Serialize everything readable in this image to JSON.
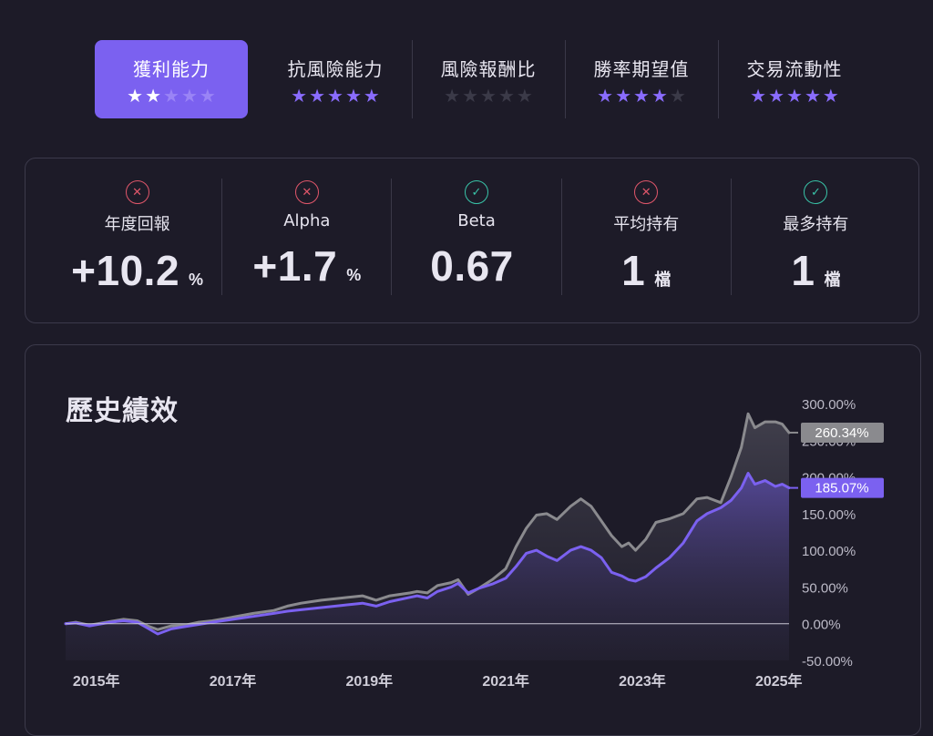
{
  "rating_tabs": [
    {
      "label": "獲利能力",
      "stars": 2,
      "max_stars": 5,
      "active": true
    },
    {
      "label": "抗風險能力",
      "stars": 5,
      "max_stars": 5,
      "active": false
    },
    {
      "label": "風險報酬比",
      "stars": 0,
      "max_stars": 5,
      "active": false
    },
    {
      "label": "勝率期望值",
      "stars": 4,
      "max_stars": 5,
      "active": false
    },
    {
      "label": "交易流動性",
      "stars": 5,
      "max_stars": 5,
      "active": false
    }
  ],
  "metrics": [
    {
      "label": "年度回報",
      "value": "+10.2",
      "unit": "%",
      "status": "bad",
      "icon": "x-circle-icon"
    },
    {
      "label": "Alpha",
      "value": "+1.7",
      "unit": "%",
      "status": "bad",
      "icon": "x-circle-icon"
    },
    {
      "label": "Beta",
      "value": "0.67",
      "unit": "",
      "status": "good",
      "icon": "check-circle-icon"
    },
    {
      "label": "平均持有",
      "value": "1",
      "unit": "檔",
      "status": "bad",
      "icon": "x-circle-icon"
    },
    {
      "label": "最多持有",
      "value": "1",
      "unit": "檔",
      "status": "good",
      "icon": "check-circle-icon"
    }
  ],
  "colors": {
    "background": "#1d1b28",
    "accent": "#7b61f0",
    "benchmark": "#8a8a8e",
    "bad": "#e0566a",
    "good": "#39c4a8"
  },
  "history": {
    "title": "歷史績效"
  },
  "chart_data": {
    "type": "line",
    "x_tick_labels": [
      "2015年",
      "2017年",
      "2019年",
      "2021年",
      "2023年",
      "2025年"
    ],
    "x_ticks": [
      2015.3,
      2017.3,
      2019.3,
      2021.3,
      2023.3,
      2025.3
    ],
    "xlim": [
      2014.85,
      2025.45
    ],
    "y_tick_labels": [
      "300.00%",
      "250.00%",
      "200.00%",
      "150.00%",
      "100.00%",
      "50.00%",
      "0.00%",
      "-50.00%"
    ],
    "y_ticks": [
      300,
      250,
      200,
      150,
      100,
      50,
      0,
      -50
    ],
    "ylim": [
      -50,
      300
    ],
    "grid": false,
    "series": [
      {
        "color": "#8a8a8e",
        "end_label": "260.34%",
        "points": [
          [
            2014.85,
            0
          ],
          [
            2015.0,
            2
          ],
          [
            2015.2,
            -2
          ],
          [
            2015.5,
            3
          ],
          [
            2015.7,
            6
          ],
          [
            2015.9,
            4
          ],
          [
            2016.05,
            -3
          ],
          [
            2016.2,
            -8
          ],
          [
            2016.4,
            -3
          ],
          [
            2016.6,
            -2
          ],
          [
            2016.8,
            2
          ],
          [
            2017.0,
            4
          ],
          [
            2017.3,
            9
          ],
          [
            2017.6,
            14
          ],
          [
            2017.9,
            18
          ],
          [
            2018.1,
            24
          ],
          [
            2018.3,
            28
          ],
          [
            2018.6,
            32
          ],
          [
            2018.9,
            35
          ],
          [
            2019.2,
            38
          ],
          [
            2019.4,
            32
          ],
          [
            2019.6,
            38
          ],
          [
            2019.9,
            42
          ],
          [
            2020.0,
            44
          ],
          [
            2020.15,
            42
          ],
          [
            2020.3,
            52
          ],
          [
            2020.5,
            56
          ],
          [
            2020.6,
            60
          ],
          [
            2020.75,
            40
          ],
          [
            2020.9,
            48
          ],
          [
            2021.1,
            60
          ],
          [
            2021.3,
            75
          ],
          [
            2021.45,
            105
          ],
          [
            2021.6,
            130
          ],
          [
            2021.75,
            148
          ],
          [
            2021.9,
            150
          ],
          [
            2022.05,
            142
          ],
          [
            2022.25,
            160
          ],
          [
            2022.4,
            170
          ],
          [
            2022.55,
            160
          ],
          [
            2022.7,
            140
          ],
          [
            2022.85,
            120
          ],
          [
            2023.0,
            105
          ],
          [
            2023.1,
            110
          ],
          [
            2023.2,
            100
          ],
          [
            2023.35,
            115
          ],
          [
            2023.5,
            138
          ],
          [
            2023.7,
            143
          ],
          [
            2023.9,
            150
          ],
          [
            2024.1,
            170
          ],
          [
            2024.25,
            172
          ],
          [
            2024.45,
            165
          ],
          [
            2024.6,
            200
          ],
          [
            2024.75,
            240
          ],
          [
            2024.85,
            286
          ],
          [
            2024.95,
            267
          ],
          [
            2025.1,
            275
          ],
          [
            2025.25,
            275
          ],
          [
            2025.35,
            272
          ],
          [
            2025.45,
            260.34
          ]
        ]
      },
      {
        "color": "#7b61f0",
        "end_label": "185.07%",
        "points": [
          [
            2014.85,
            0
          ],
          [
            2015.0,
            1
          ],
          [
            2015.2,
            -3
          ],
          [
            2015.5,
            2
          ],
          [
            2015.7,
            4
          ],
          [
            2015.9,
            2
          ],
          [
            2016.05,
            -6
          ],
          [
            2016.2,
            -14
          ],
          [
            2016.4,
            -7
          ],
          [
            2016.6,
            -4
          ],
          [
            2016.8,
            -1
          ],
          [
            2017.0,
            2
          ],
          [
            2017.3,
            6
          ],
          [
            2017.6,
            10
          ],
          [
            2017.9,
            14
          ],
          [
            2018.1,
            17
          ],
          [
            2018.3,
            19
          ],
          [
            2018.6,
            22
          ],
          [
            2018.9,
            25
          ],
          [
            2019.2,
            28
          ],
          [
            2019.4,
            24
          ],
          [
            2019.6,
            30
          ],
          [
            2019.9,
            36
          ],
          [
            2020.0,
            38
          ],
          [
            2020.15,
            35
          ],
          [
            2020.3,
            44
          ],
          [
            2020.5,
            50
          ],
          [
            2020.6,
            55
          ],
          [
            2020.75,
            42
          ],
          [
            2020.9,
            48
          ],
          [
            2021.1,
            54
          ],
          [
            2021.3,
            62
          ],
          [
            2021.45,
            78
          ],
          [
            2021.6,
            96
          ],
          [
            2021.75,
            100
          ],
          [
            2021.9,
            92
          ],
          [
            2022.05,
            86
          ],
          [
            2022.25,
            100
          ],
          [
            2022.4,
            105
          ],
          [
            2022.55,
            100
          ],
          [
            2022.7,
            90
          ],
          [
            2022.85,
            70
          ],
          [
            2023.0,
            65
          ],
          [
            2023.1,
            60
          ],
          [
            2023.2,
            58
          ],
          [
            2023.35,
            64
          ],
          [
            2023.5,
            76
          ],
          [
            2023.7,
            90
          ],
          [
            2023.9,
            110
          ],
          [
            2024.1,
            140
          ],
          [
            2024.25,
            150
          ],
          [
            2024.45,
            158
          ],
          [
            2024.6,
            168
          ],
          [
            2024.75,
            185
          ],
          [
            2024.85,
            205
          ],
          [
            2024.95,
            190
          ],
          [
            2025.1,
            195
          ],
          [
            2025.25,
            187
          ],
          [
            2025.35,
            190
          ],
          [
            2025.45,
            185.07
          ]
        ]
      }
    ]
  }
}
